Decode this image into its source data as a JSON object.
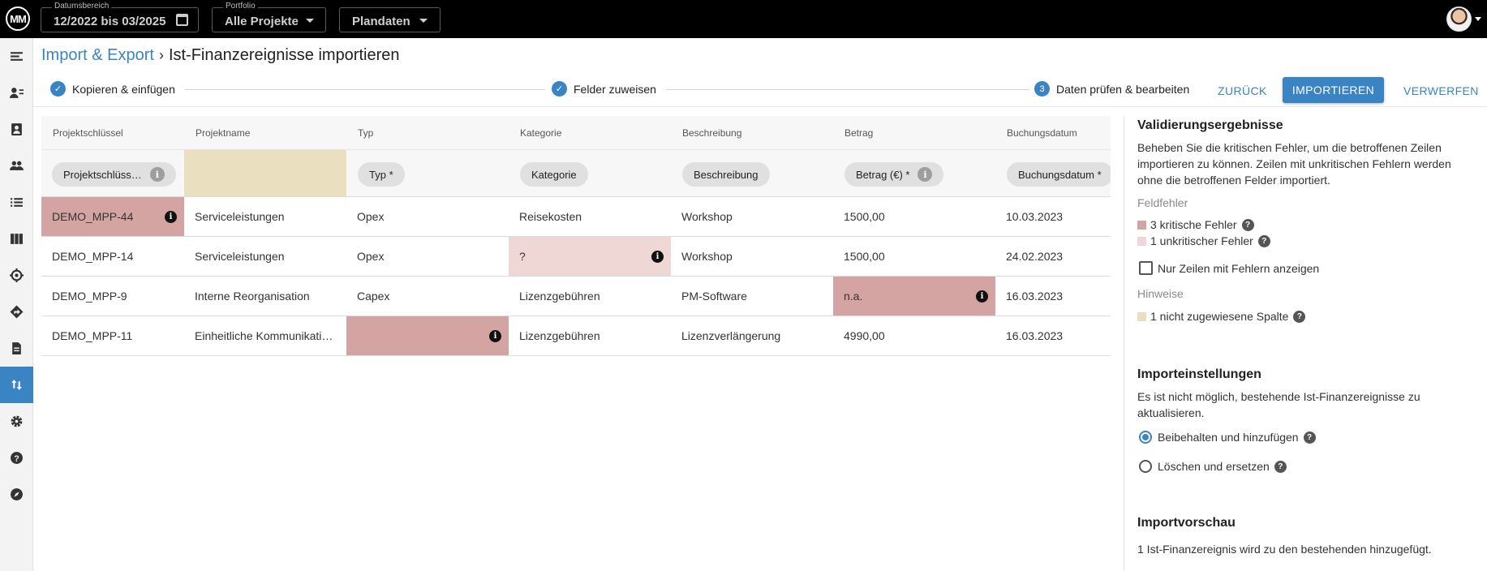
{
  "topbar": {
    "logo_text": "MM",
    "date_range": {
      "label": "Datumsbereich",
      "value": "12/2022 bis 03/2025"
    },
    "portfolio": {
      "label": "Portfolio",
      "value": "Alle Projekte"
    },
    "plan": {
      "value": "Plandaten"
    }
  },
  "breadcrumb": {
    "parent": "Import & Export",
    "separator": "›",
    "current": "Ist-Finanzereignisse importieren"
  },
  "stepper": {
    "steps": [
      {
        "label": "Kopieren & einfügen",
        "state": "done"
      },
      {
        "label": "Felder zuweisen",
        "state": "done"
      },
      {
        "label": "Daten prüfen & bearbeiten",
        "state": "active",
        "number": "3"
      }
    ],
    "check": "✓"
  },
  "actions": {
    "back": "ZURÜCK",
    "import": "IMPORTIEREN",
    "discard": "VERWERFEN"
  },
  "table": {
    "headers": [
      "Projektschlüssel",
      "Projektname",
      "Typ",
      "Kategorie",
      "Beschreibung",
      "Betrag",
      "Buchungsdatum"
    ],
    "mappings": [
      "Projektschlüss…",
      "",
      "Typ *",
      "Kategorie",
      "Beschreibung",
      "Betrag (€) *",
      "Buchungsdatum *"
    ],
    "info_glyph": "i",
    "rows": [
      [
        "DEMO_MPP-44",
        "Serviceleistungen",
        "Opex",
        "Reisekosten",
        "Workshop",
        "1500,00",
        "10.03.2023"
      ],
      [
        "DEMO_MPP-14",
        "Serviceleistungen",
        "Opex",
        "?",
        "Workshop",
        "1500,00",
        "24.02.2023"
      ],
      [
        "DEMO_MPP-9",
        "Interne Reorganisation",
        "Capex",
        "Lizenzgebühren",
        "PM-Software",
        "n.a.",
        "16.03.2023"
      ],
      [
        "DEMO_MPP-11",
        "Einheitliche Kommunikati…",
        "",
        "Lizenzgebühren",
        "Lizenzverlängerung",
        "4990,00",
        "16.03.2023"
      ]
    ]
  },
  "validation": {
    "title": "Validierungsergebnisse",
    "text": "Beheben Sie die kritischen Fehler, um die betroffenen Zeilen importieren zu können. Zeilen mit unkritischen Fehlern werden ohne die betroffenen Felder importiert.",
    "field_errors_label": "Feldfehler",
    "critical": "3 kritische Fehler",
    "noncritical": "1 unkritischer Fehler",
    "only_errors": "Nur Zeilen mit Fehlern anzeigen",
    "hints_label": "Hinweise",
    "unassigned": "1 nicht zugewiesene Spalte",
    "help_glyph": "?"
  },
  "import_settings": {
    "title": "Importeinstellungen",
    "text": "Es ist nicht möglich, bestehende Ist-Finanzereignisse zu aktualisieren.",
    "option_keep": "Beibehalten und hinzufügen",
    "option_replace": "Löschen und ersetzen",
    "selected": "Beibehalten und hinzufügen"
  },
  "preview": {
    "title": "Importvorschau",
    "text": "1 Ist-Finanzereignis wird zu den bestehenden hinzugefügt."
  },
  "colors": {
    "accent": "#3a84c3",
    "critical_error": "#d3a4a1",
    "noncritical_error": "#eed7d5",
    "unassigned": "#eae0c0"
  }
}
